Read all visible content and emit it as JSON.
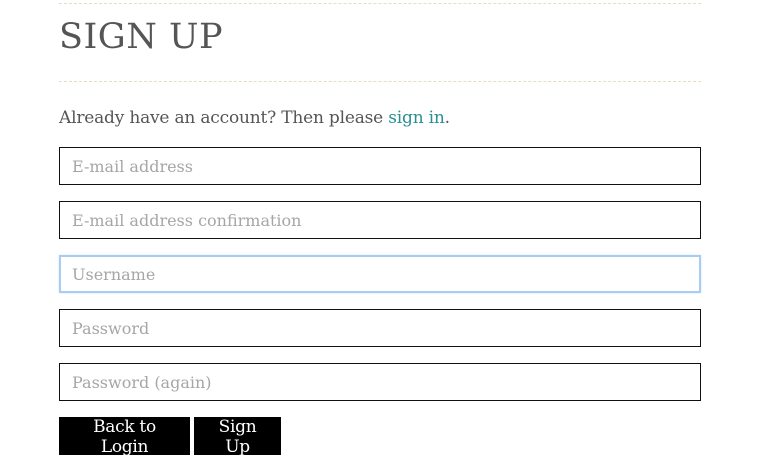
{
  "heading": "SIGN UP",
  "signin_prompt": {
    "text": "Already have an account? Then please",
    "link": "sign in",
    "suffix": "."
  },
  "fields": {
    "email": {
      "placeholder": "E-mail address",
      "value": ""
    },
    "email_confirm": {
      "placeholder": "E-mail address confirmation",
      "value": ""
    },
    "username": {
      "placeholder": "Username",
      "value": ""
    },
    "password": {
      "placeholder": "Password",
      "value": ""
    },
    "password_again": {
      "placeholder": "Password (again)",
      "value": ""
    }
  },
  "buttons": {
    "back_label": "Back to Login",
    "signup_label": "Sign Up"
  },
  "colors": {
    "link": "#2a8f93",
    "button_bg": "#000000",
    "focus_border": "#a9ccf2"
  }
}
